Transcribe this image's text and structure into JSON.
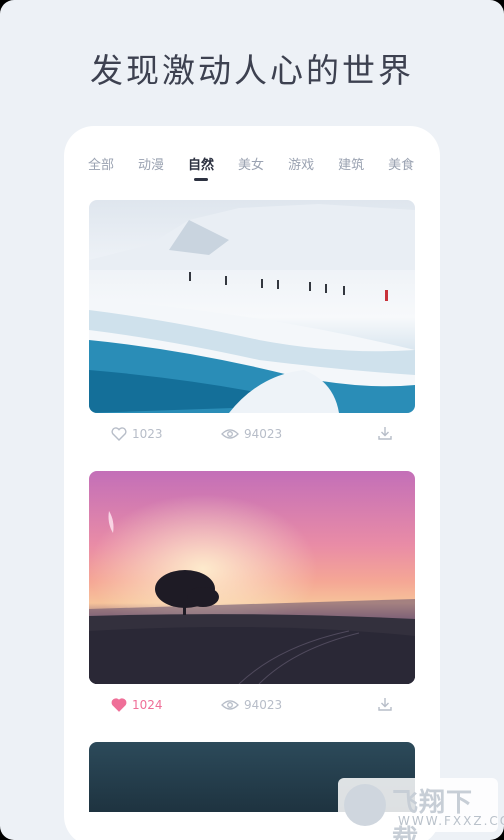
{
  "headline": "发现激动人心的世界",
  "tabs": [
    "全部",
    "动漫",
    "自然",
    "美女",
    "游戏",
    "建筑",
    "美食"
  ],
  "active_tab": "自然",
  "cards": [
    {
      "likes": "1023",
      "views": "94023",
      "liked": false,
      "image": "snowy-glacier-hikers"
    },
    {
      "likes": "1024",
      "views": "94023",
      "liked": true,
      "image": "sunset-tree-field"
    },
    {
      "image": "night-sky"
    }
  ],
  "watermark": {
    "text": "飞翔下载",
    "sub": "WWW.FXXZ.COM"
  },
  "colors": {
    "accent_like": "#ef6f98",
    "text_dark": "#2c3140",
    "muted": "#b7bdc8",
    "background": "#edf1f6"
  }
}
